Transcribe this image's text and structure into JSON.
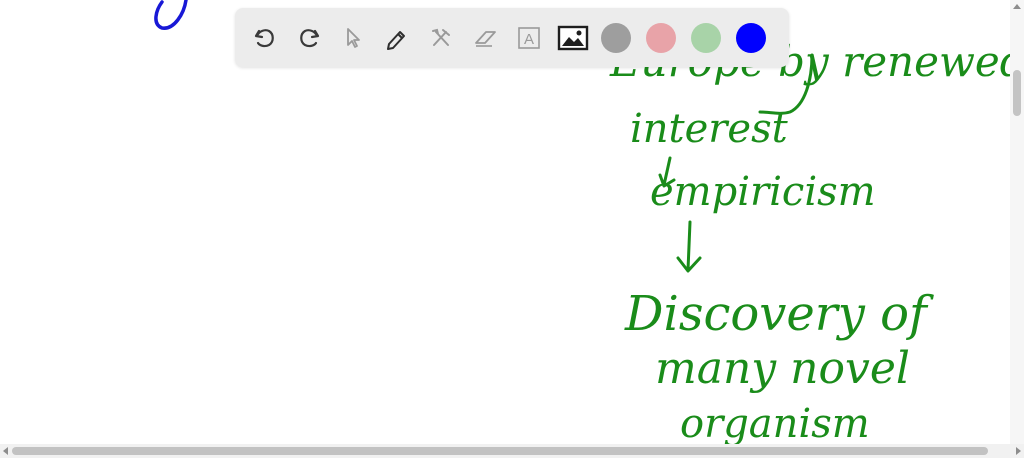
{
  "toolbar": {
    "tools": [
      {
        "name": "undo-icon"
      },
      {
        "name": "redo-icon"
      },
      {
        "name": "select-cursor-icon"
      },
      {
        "name": "pen-icon"
      },
      {
        "name": "tools-icon"
      },
      {
        "name": "eraser-icon"
      },
      {
        "name": "text-tool-icon",
        "glyph": "A"
      },
      {
        "name": "image-icon"
      }
    ],
    "colors": [
      {
        "name": "gray",
        "hex": "#9e9e9e"
      },
      {
        "name": "pink",
        "hex": "#e8a3a8"
      },
      {
        "name": "light-green",
        "hex": "#a8d3a8"
      },
      {
        "name": "blue",
        "hex": "#0000ff",
        "selected": true
      }
    ]
  },
  "canvas": {
    "ink_colors": {
      "green": "#1a8c1a",
      "blue": "#1818d6"
    },
    "handwriting": {
      "line1": "Europe by renewed",
      "line2": "interest",
      "line3": "empiricism",
      "line4": "Discovery of",
      "line5": "many novel",
      "line6": "organism"
    }
  }
}
